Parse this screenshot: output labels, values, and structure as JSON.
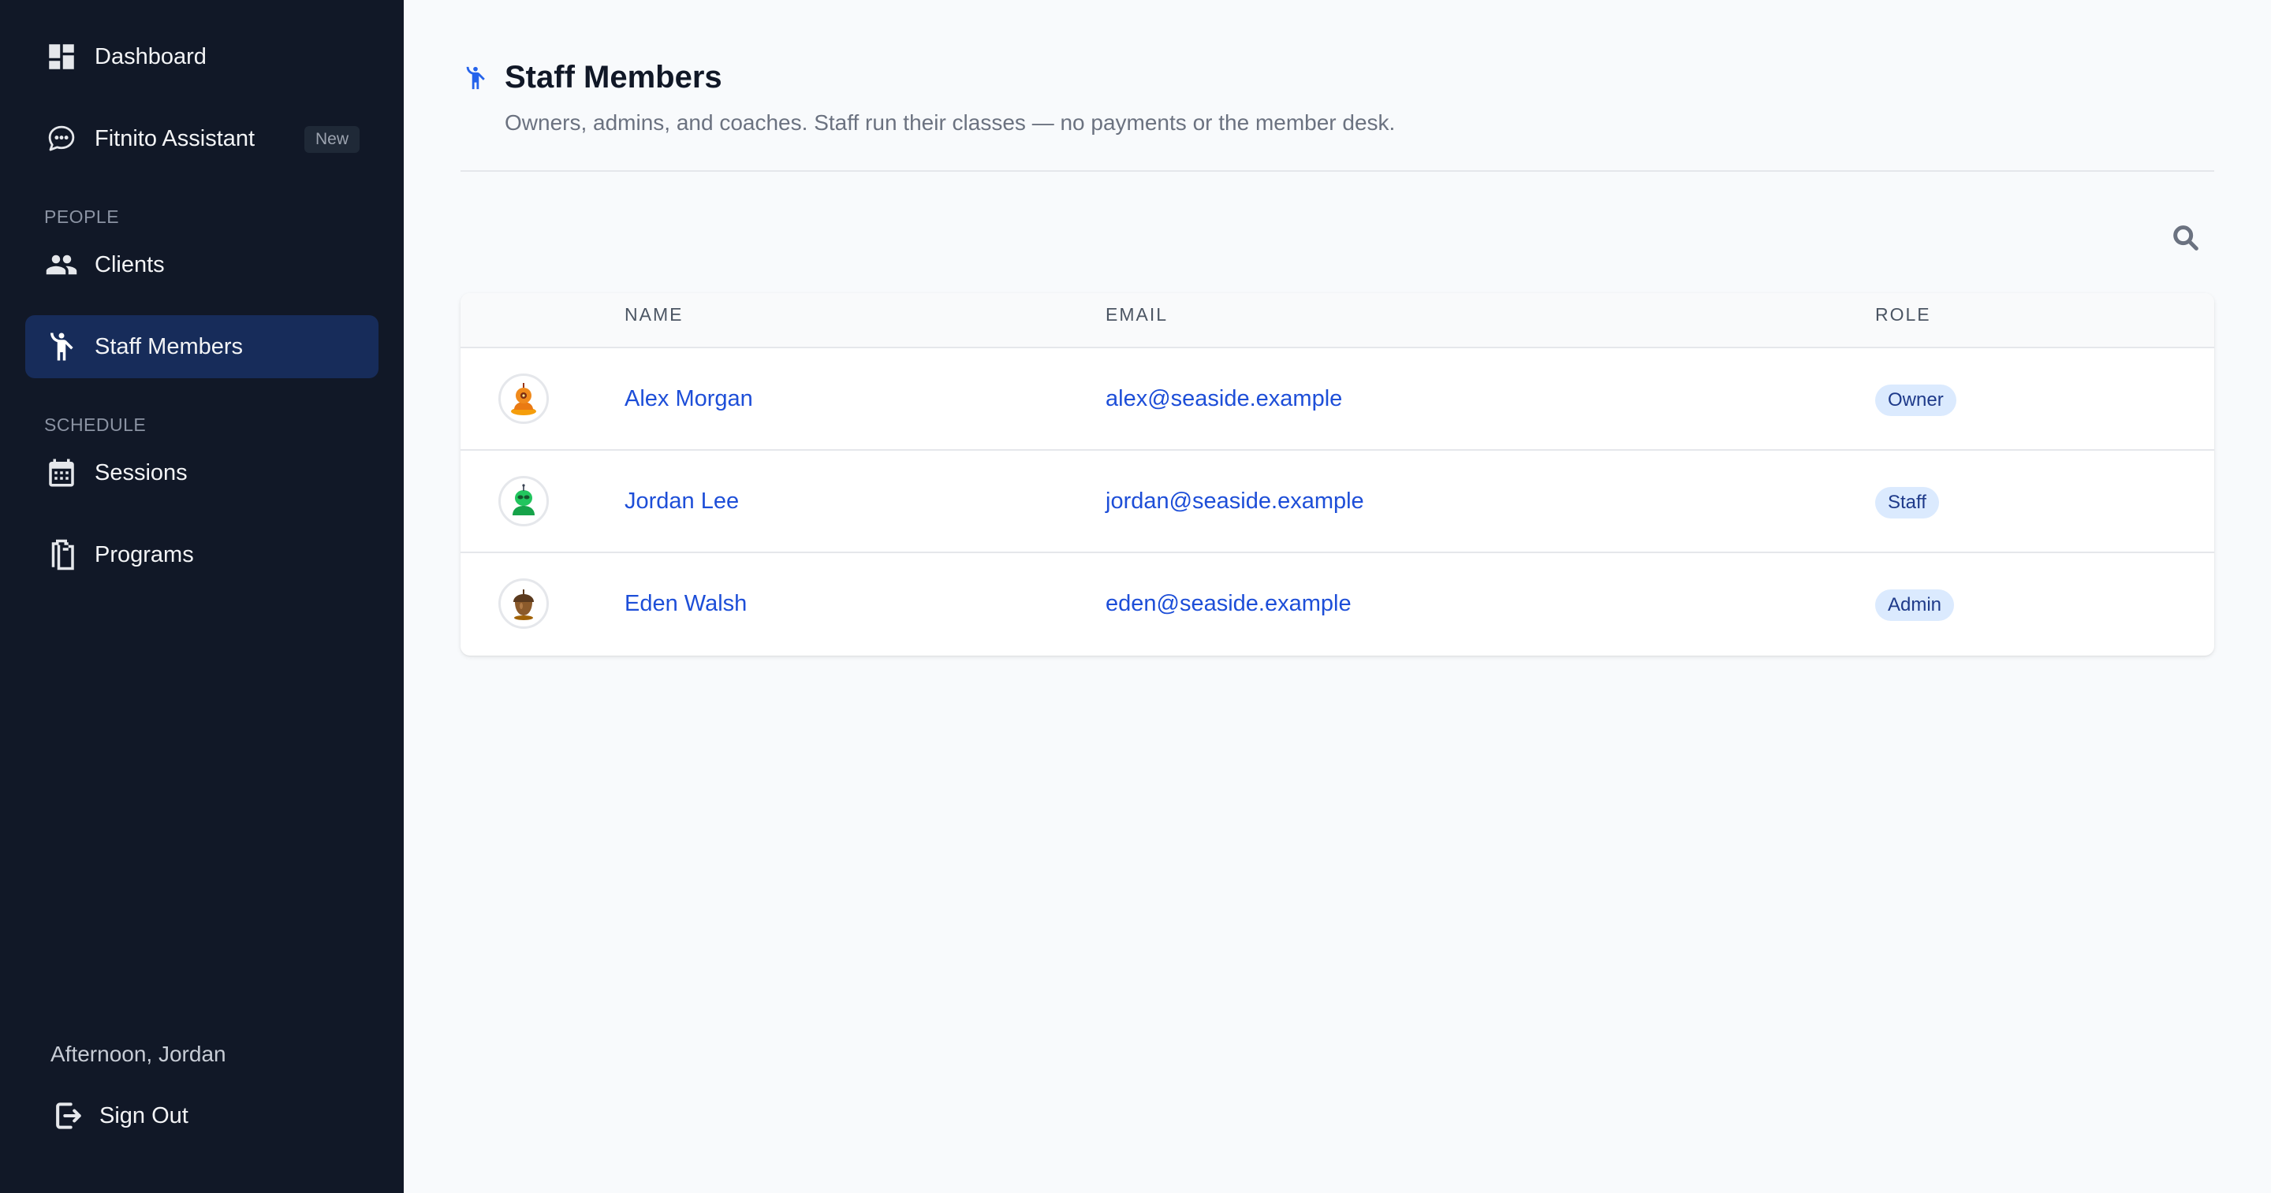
{
  "sidebar": {
    "nav": [
      {
        "label": "Dashboard",
        "icon": "dashboard-icon"
      },
      {
        "label": "Fitnito Assistant",
        "icon": "chat-bubble-icon",
        "badge": "New"
      },
      {
        "label": "Clients",
        "icon": "people-icon"
      },
      {
        "label": "Staff Members",
        "icon": "person-raised-arms-icon",
        "active": true
      },
      {
        "label": "Sessions",
        "icon": "calendar-icon"
      },
      {
        "label": "Programs",
        "icon": "clipboards-icon"
      }
    ],
    "sections": {
      "people": "PEOPLE",
      "schedule": "SCHEDULE"
    },
    "greeting": "Afternoon, Jordan",
    "signout_label": "Sign Out"
  },
  "header": {
    "icon": "person-raised-arms-icon",
    "title": "Staff Members",
    "subtitle": "Owners, admins, and coaches. Staff run their classes — no payments or the member desk."
  },
  "toolbar": {
    "search_icon": "search-icon"
  },
  "table": {
    "columns": [
      "NAME",
      "EMAIL",
      "ROLE"
    ],
    "rows": [
      {
        "name": "Alex Morgan",
        "email": "alex@seaside.example",
        "role": "Owner",
        "avatar": "orange-robot-avatar"
      },
      {
        "name": "Jordan Lee",
        "email": "jordan@seaside.example",
        "role": "Staff",
        "avatar": "green-alien-avatar"
      },
      {
        "name": "Eden Walsh",
        "email": "eden@seaside.example",
        "role": "Admin",
        "avatar": "brown-acorn-avatar"
      }
    ]
  },
  "colors": {
    "sidebar_bg": "#111827",
    "active_nav_bg": "#172c5a",
    "accent": "#2563eb",
    "link": "#1d4ed8",
    "badge_bg": "#dbeafe"
  }
}
